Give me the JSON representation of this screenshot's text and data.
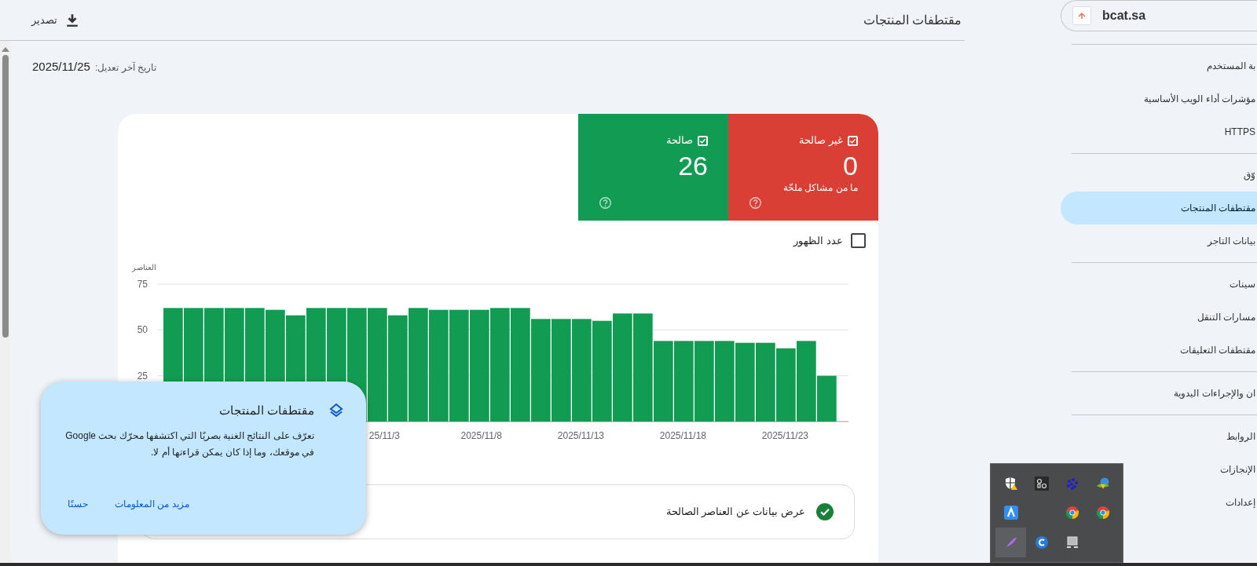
{
  "header": {
    "title": "مقتطفات المنتجات",
    "export_label": "تصدير"
  },
  "last_updated": {
    "label": "تاريخ آخر تعديل:",
    "value": "2025/11/25"
  },
  "tiles": [
    {
      "kind": "invalid",
      "label": "غير صالحة",
      "checked": true,
      "count": "0",
      "note": "ما من مشاكل ملحّة"
    },
    {
      "kind": "valid",
      "label": "صالحة",
      "checked": true,
      "count": "26"
    }
  ],
  "impressions": {
    "label": "عدد الظهور",
    "checked": false
  },
  "chart_data": {
    "type": "bar",
    "ylabel": "العناصر",
    "ylim": [
      0,
      75
    ],
    "yticks": [
      25,
      50,
      75
    ],
    "categories": [
      null,
      null,
      null,
      null,
      null,
      null,
      null,
      null,
      null,
      null,
      "25/11/3",
      null,
      null,
      null,
      null,
      "2025/11/8",
      null,
      null,
      null,
      null,
      "2025/11/13",
      null,
      null,
      null,
      null,
      "2025/11/18",
      null,
      null,
      null,
      null,
      "2025/11/23",
      null,
      null
    ],
    "values": [
      62,
      62,
      62,
      62,
      62,
      61,
      58,
      62,
      62,
      62,
      62,
      58,
      62,
      61,
      61,
      61,
      62,
      62,
      56,
      56,
      56,
      55,
      59,
      59,
      44,
      44,
      44,
      44,
      43,
      43,
      40,
      44,
      25
    ]
  },
  "details_row": {
    "label": "عرض بيانات عن العناصر الصالحة"
  },
  "popup": {
    "title": "مقتطفات المنتجات",
    "body": "تعرّف على النتائج الغنية بصريًا التي اكتشفها محرّك بحث Google في موقعك، وما إذا كان يمكن قراءتها أم لا.",
    "buttons": [
      "مزيد من المعلومات",
      "حسنًا"
    ]
  },
  "property": {
    "name": "bcat.sa"
  },
  "sidebar": {
    "groups": [
      {
        "items": [
          {
            "label": "بة المستخدم",
            "selected": false
          },
          {
            "label": "مؤشرات أداء الويب الأساسية",
            "selected": false
          },
          {
            "label": "HTTPS",
            "selected": false
          }
        ]
      },
      {
        "items": [
          {
            "label": "وّق",
            "selected": false
          },
          {
            "label": "مقتطفات المنتجات",
            "selected": true
          },
          {
            "label": "بيانات التاجر",
            "selected": false
          }
        ]
      },
      {
        "items": [
          {
            "label": "سينات",
            "selected": false
          },
          {
            "label": "مسارات التنقل",
            "selected": false
          },
          {
            "label": "مقتطفات التعليقات",
            "selected": false
          }
        ]
      },
      {
        "items": [
          {
            "label": "ان والإجراءات اليدوية",
            "selected": false
          }
        ]
      },
      {
        "items": [
          {
            "label": "الروابط",
            "selected": false
          },
          {
            "label": "الإنجازات",
            "selected": false
          },
          {
            "label": "إعدادات",
            "selected": false
          }
        ]
      }
    ]
  }
}
